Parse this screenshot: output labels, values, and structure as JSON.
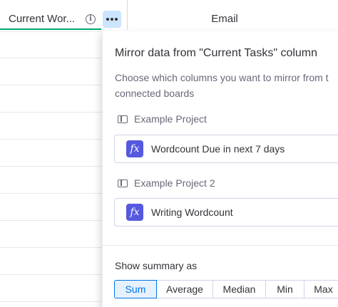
{
  "header": {
    "current_column_title": "Current Wor...",
    "email_column_title": "Email"
  },
  "popover": {
    "title": "Mirror data from \"Current Tasks\" column",
    "description_line1": "Choose which columns you want to mirror from t",
    "description_line2": "connected boards",
    "boards": [
      {
        "name": "Example Project",
        "column": "Wordcount Due in next 7 days"
      },
      {
        "name": "Example Project 2",
        "column": "Writing Wordcount"
      }
    ],
    "fx_symbol": "fx",
    "summary": {
      "label": "Show summary as",
      "options": [
        "Sum",
        "Average",
        "Median",
        "Min",
        "Max"
      ],
      "selected": "Sum"
    }
  },
  "colors": {
    "accent": "#0073ea",
    "formula_icon_bg": "#5559df",
    "active_column_underline": "#00a86b",
    "more_button_bg": "#cce5ff"
  },
  "icons": {
    "info": "info-icon",
    "more": "more-horizontal-icon",
    "board": "board-icon",
    "formula": "formula-fx-icon"
  }
}
